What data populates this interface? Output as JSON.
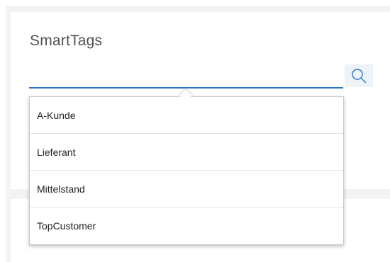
{
  "colors": {
    "background": "#f3f3f3",
    "card": "#ffffff",
    "accent": "#2b75c2",
    "search_button_bg": "#eef3f8",
    "title_text": "#505050"
  },
  "card": {
    "title": "SmartTags"
  },
  "search": {
    "value": "",
    "placeholder": "",
    "button_icon": "search-icon"
  },
  "dropdown": {
    "items": [
      {
        "label": "A-Kunde"
      },
      {
        "label": "Lieferant"
      },
      {
        "label": "Mittelstand"
      },
      {
        "label": "TopCustomer"
      }
    ]
  }
}
